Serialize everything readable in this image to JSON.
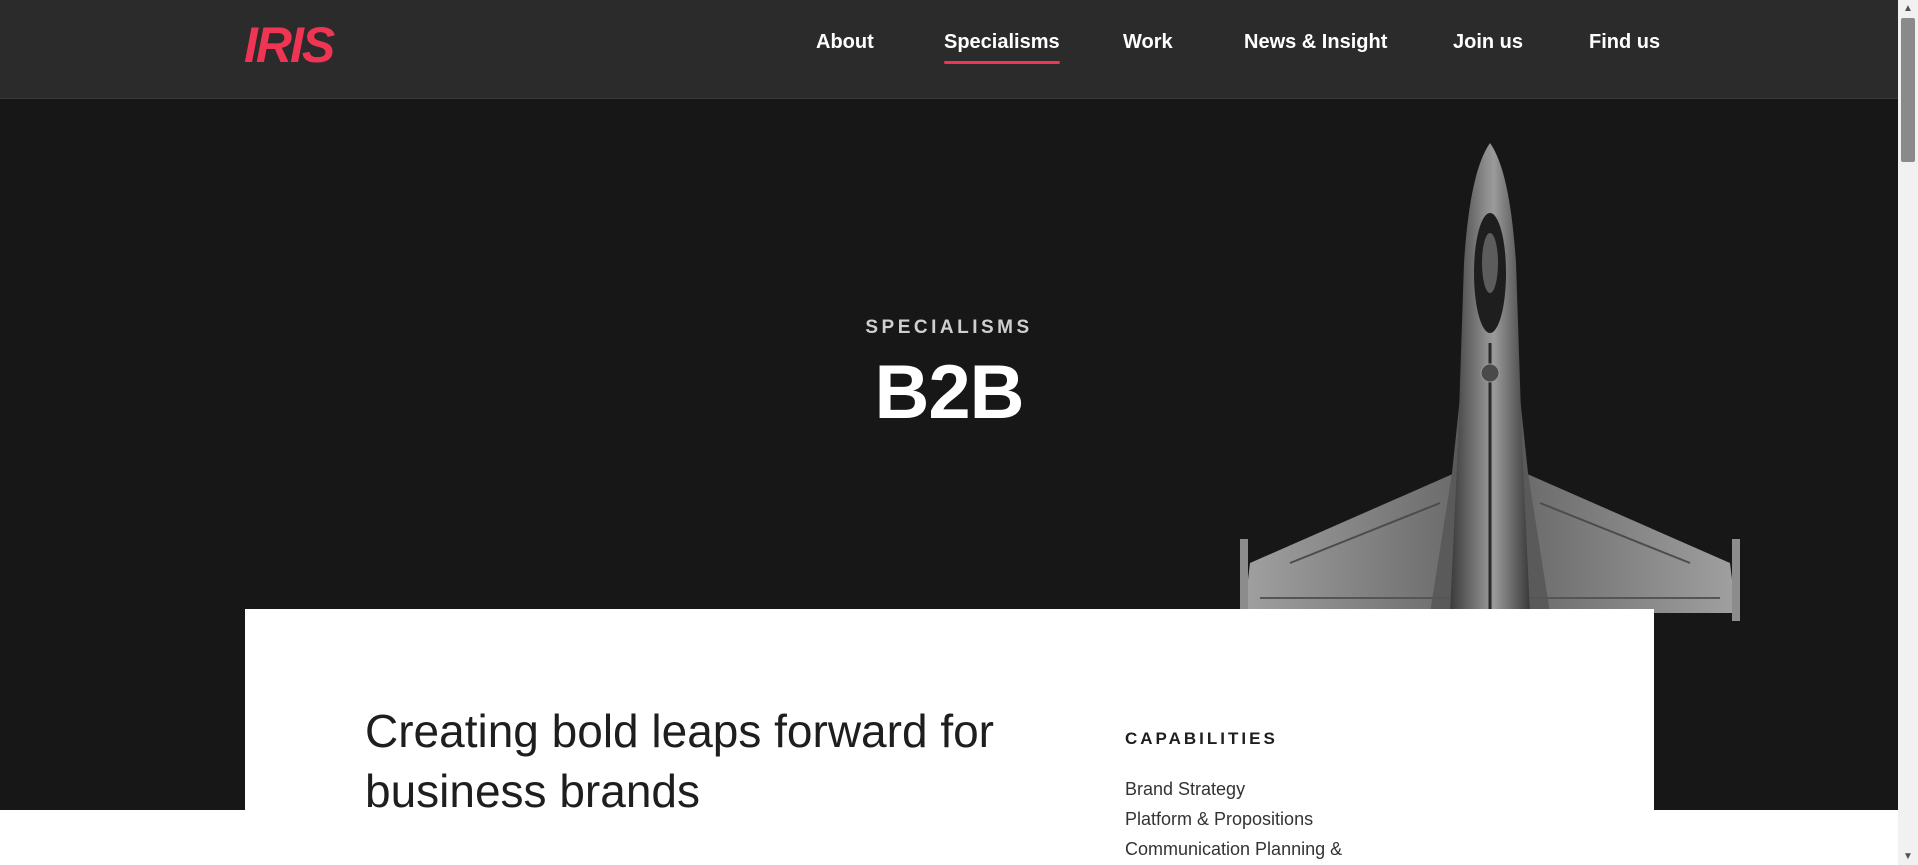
{
  "header": {
    "logo_text": "IRIS",
    "nav": [
      {
        "label": "About"
      },
      {
        "label": "Specialisms",
        "active": true
      },
      {
        "label": "Work"
      },
      {
        "label": "News & Insight"
      },
      {
        "label": "Join us"
      },
      {
        "label": "Find us"
      }
    ]
  },
  "hero": {
    "eyebrow": "SPECIALISMS",
    "title": "B2B",
    "image_icon": "fighter-jet-image"
  },
  "intro": {
    "heading": "Creating bold leaps forward for business brands",
    "capabilities_title": "CAPABILITIES",
    "capabilities": [
      "Brand Strategy",
      "Platform & Propositions",
      "Communication Planning &"
    ]
  },
  "colors": {
    "accent": "#ef3553",
    "header_bg": "#2b2b2b",
    "hero_bg": "#171717",
    "card_bg": "#ffffff"
  },
  "scrollbar": {
    "up_icon": "chevron-up-icon",
    "down_icon": "chevron-down-icon"
  }
}
